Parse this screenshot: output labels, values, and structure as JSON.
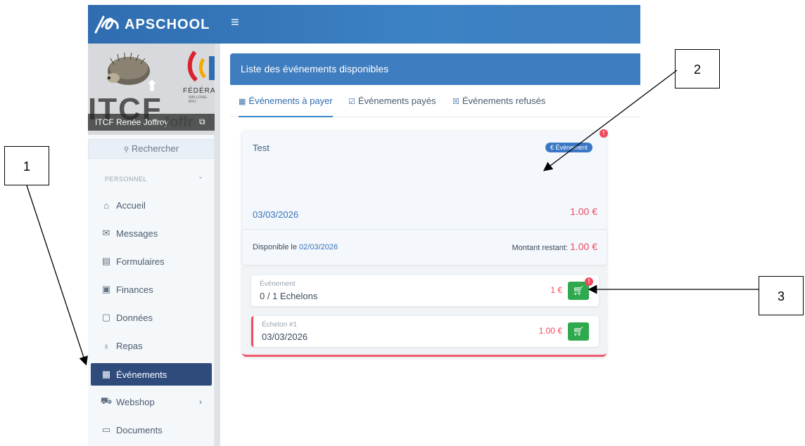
{
  "app": {
    "name": "APSCHOOL"
  },
  "profile": {
    "name": "ITCF Renée Joffroy",
    "name_ghost": "Joffr",
    "org_big": "ITCF",
    "fed_text": "FÉDÉRAT",
    "fed_sub": "WALLONIE-BRU"
  },
  "sidebar": {
    "search_label": "Rechercher",
    "section_label": "PERSONNEL",
    "items": [
      {
        "label": "Accueil",
        "icon": "home-icon"
      },
      {
        "label": "Messages",
        "icon": "envelope-icon"
      },
      {
        "label": "Formulaires",
        "icon": "form-icon"
      },
      {
        "label": "Finances",
        "icon": "finance-icon"
      },
      {
        "label": "Données",
        "icon": "data-icon"
      },
      {
        "label": "Repas",
        "icon": "meal-icon"
      },
      {
        "label": "Événements",
        "icon": "calendar-icon",
        "active": true
      },
      {
        "label": "Webshop",
        "icon": "cart-icon",
        "has_submenu": true
      },
      {
        "label": "Documents",
        "icon": "folder-icon"
      }
    ]
  },
  "main": {
    "header": "Liste des événements disponibles",
    "tabs": [
      {
        "label": "Événements à payer",
        "active": true
      },
      {
        "label": "Événements payés"
      },
      {
        "label": "Événements refusés"
      }
    ],
    "card": {
      "title": "Test",
      "badge": "€ Événement",
      "alert": "!",
      "date": "03/03/2026",
      "price": "1.00 €",
      "available_label": "Disponible le",
      "available_date": "02/03/2026",
      "remaining_label": "Montant restant:",
      "remaining_value": "1.00 €",
      "rows": [
        {
          "label": "Événement",
          "value": "0 / 1 Echelons",
          "price": "1 €",
          "alert": "!"
        },
        {
          "label": "Échelon #1",
          "value": "03/03/2026",
          "price": "1.00 €"
        }
      ]
    }
  },
  "annotations": {
    "callout_1": "1",
    "callout_2": "2",
    "callout_3": "3"
  },
  "colors": {
    "topbar": "#3b82c4",
    "active_nav": "#2f4b7c",
    "accent_red": "#ef4b60",
    "cart_green": "#2fa94e"
  }
}
